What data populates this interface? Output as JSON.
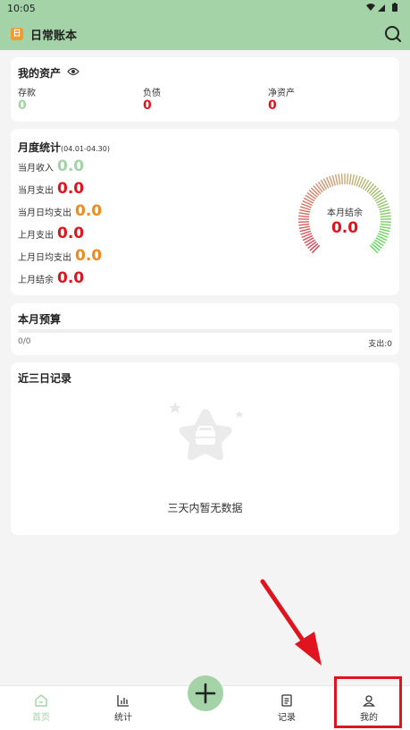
{
  "status": {
    "time": "10:05"
  },
  "app": {
    "title": "日常账本",
    "logo_glyph": "日"
  },
  "assets": {
    "title": "我的资产",
    "items": [
      {
        "label": "存款",
        "value": "0"
      },
      {
        "label": "负债",
        "value": "0"
      },
      {
        "label": "净资产",
        "value": "0"
      }
    ]
  },
  "monthly": {
    "title": "月度统计",
    "range": "(04.01-04.30)",
    "rows": [
      {
        "label": "当月收入",
        "value": "0.0"
      },
      {
        "label": "当月支出",
        "value": "0.0"
      },
      {
        "label": "当月日均支出",
        "value": "0.0"
      },
      {
        "label": "上月支出",
        "value": "0.0"
      },
      {
        "label": "上月日均支出",
        "value": "0.0"
      },
      {
        "label": "上月结余",
        "value": "0.0"
      }
    ],
    "gauge": {
      "label": "本月结余",
      "value": "0.0"
    }
  },
  "budget": {
    "title": "本月预算",
    "progress": "0/0",
    "spent": "支出:0"
  },
  "recent": {
    "title": "近三日记录",
    "empty_text": "三天内暂无数据"
  },
  "nav": {
    "home": "首页",
    "stats": "统计",
    "records": "记录",
    "mine": "我的"
  },
  "colors": {
    "accent": "#a3d3a6",
    "expense": "#e0141e",
    "average": "#f08a1c",
    "highlight": "#e0141e"
  }
}
